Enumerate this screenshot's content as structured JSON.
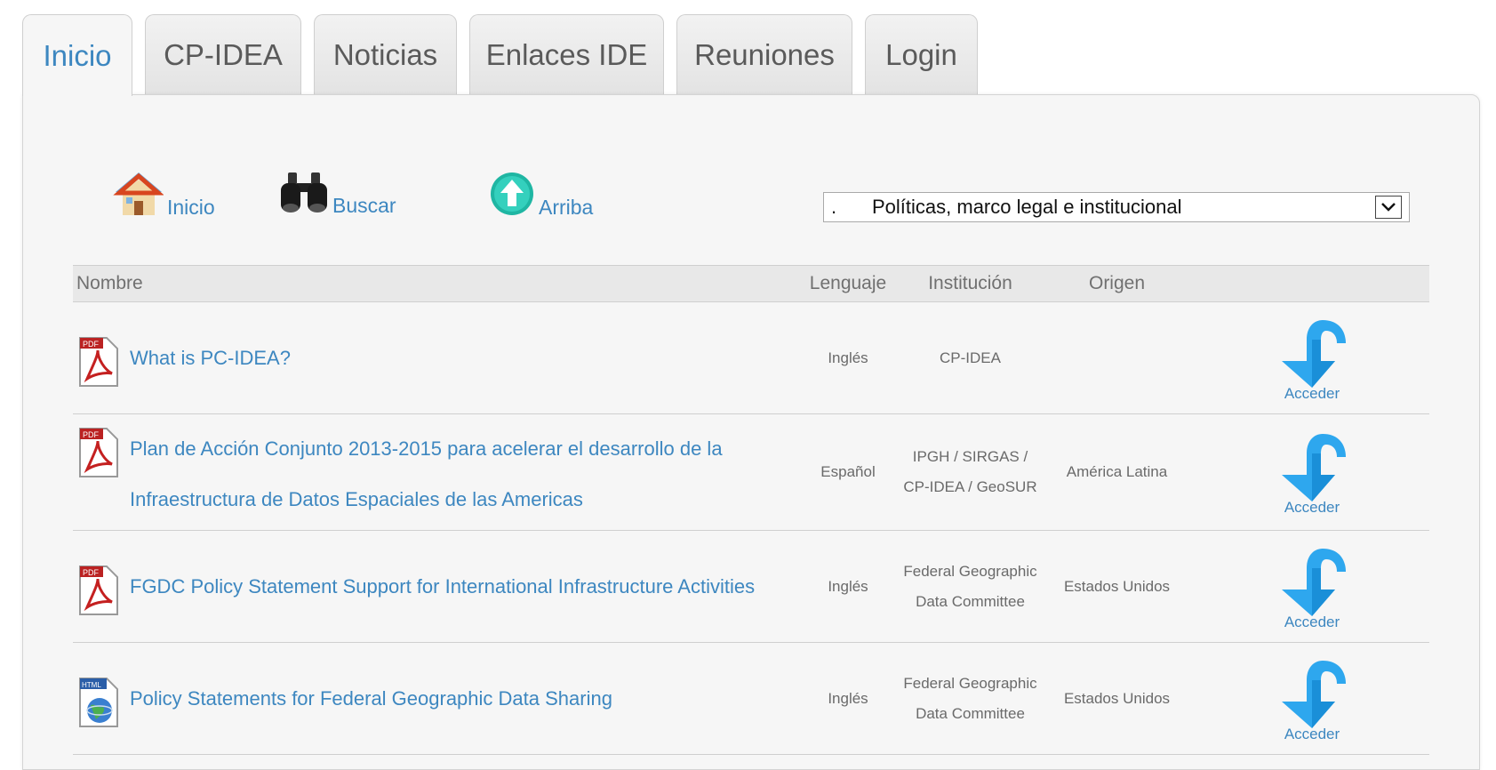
{
  "tabs": [
    {
      "label": "Inicio",
      "active": true
    },
    {
      "label": "CP-IDEA",
      "active": false
    },
    {
      "label": "Noticias",
      "active": false
    },
    {
      "label": "Enlaces IDE",
      "active": false
    },
    {
      "label": "Reuniones",
      "active": false
    },
    {
      "label": "Login",
      "active": false
    }
  ],
  "toolbar": {
    "home_label": "Inicio",
    "search_label": "Buscar",
    "up_label": "Arriba"
  },
  "category_select": {
    "prefix": ".",
    "value": "Políticas, marco legal e institucional"
  },
  "table": {
    "headers": {
      "name": "Nombre",
      "language": "Lenguaje",
      "institution": "Institución",
      "origin": "Origen"
    },
    "rows": [
      {
        "title": "What is PC-IDEA?",
        "file_type": "PDF",
        "language": "Inglés",
        "institution": "CP-IDEA",
        "origin": "",
        "action": "Acceder"
      },
      {
        "title": "Plan de Acción Conjunto 2013-2015 para acelerar el desarrollo de la Infraestructura de Datos Espaciales de las Americas",
        "file_type": "PDF",
        "language": "Español",
        "institution": "IPGH / SIRGAS / CP-IDEA / GeoSUR",
        "origin": "América Latina",
        "action": "Acceder"
      },
      {
        "title": "FGDC Policy Statement Support for International Infrastructure Activities",
        "file_type": "PDF",
        "language": "Inglés",
        "institution": "Federal Geographic Data Committee",
        "origin": "Estados Unidos",
        "action": "Acceder"
      },
      {
        "title": "Policy Statements for Federal Geographic Data Sharing",
        "file_type": "HTML",
        "language": "Inglés",
        "institution": "Federal Geographic Data Committee",
        "origin": "Estados Unidos",
        "action": "Acceder"
      }
    ]
  },
  "colors": {
    "link": "#3d87c0",
    "panel": "#f6f6f6",
    "header_bg": "#e8e8e8"
  }
}
